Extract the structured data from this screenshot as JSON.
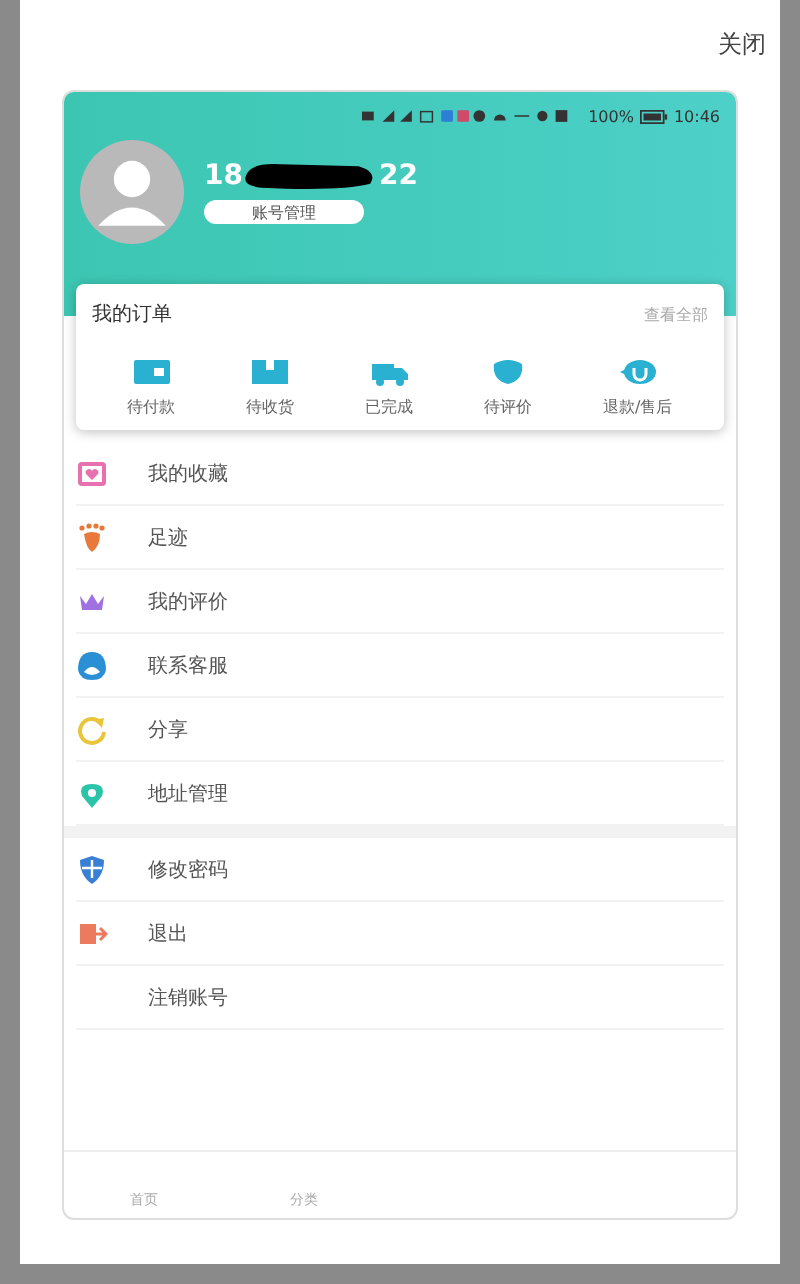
{
  "close_label": "关闭",
  "status_bar": {
    "battery": "100%",
    "time": "10:46"
  },
  "profile": {
    "phone_start": "18",
    "phone_end": "22",
    "account_button": "账号管理"
  },
  "orders": {
    "title": "我的订单",
    "view_all": "查看全部",
    "items": [
      {
        "kind": "wallet",
        "label": "待付款"
      },
      {
        "kind": "box",
        "label": "待收货"
      },
      {
        "kind": "truck",
        "label": "已完成"
      },
      {
        "kind": "chat",
        "label": "待评价"
      },
      {
        "kind": "refund",
        "label": "退款/售后"
      }
    ]
  },
  "menu_groups": [
    [
      {
        "kind": "favorites",
        "label": "我的收藏",
        "color": "#e86fb0"
      },
      {
        "kind": "footprint",
        "label": "足迹",
        "color": "#e8793a"
      },
      {
        "kind": "crown",
        "label": "我的评价",
        "color": "#a071e0"
      },
      {
        "kind": "service",
        "label": "联系客服",
        "color": "#2b8fd6"
      },
      {
        "kind": "share",
        "label": "分享",
        "color": "#e8c53a"
      },
      {
        "kind": "location",
        "label": "地址管理",
        "color": "#2cc4a8"
      }
    ],
    [
      {
        "kind": "shield",
        "label": "修改密码",
        "color": "#3a7fd6"
      },
      {
        "kind": "logout",
        "label": "退出",
        "color": "#ec7a5e"
      },
      {
        "kind": "none",
        "label": "注销账号"
      }
    ]
  ],
  "bottom_nav": [
    {
      "label": "首页"
    },
    {
      "label": "分类"
    }
  ]
}
